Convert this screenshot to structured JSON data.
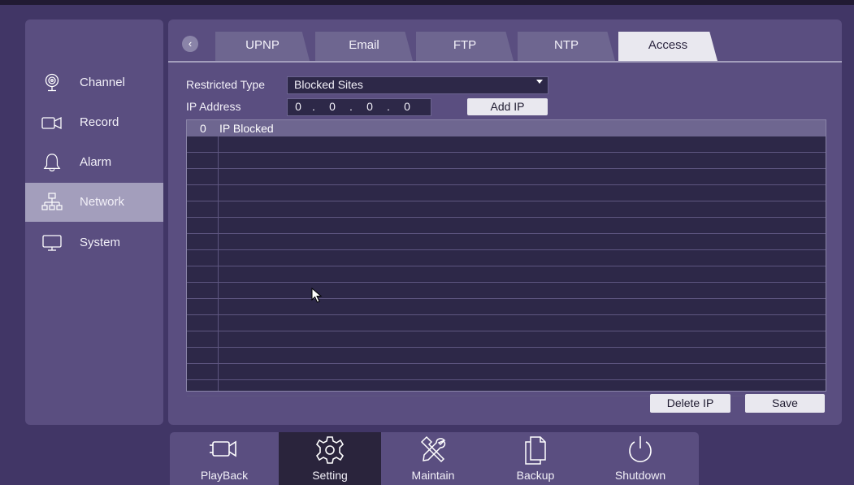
{
  "sidebar": {
    "items": [
      {
        "label": "Channel",
        "icon": "webcam-icon",
        "active": false
      },
      {
        "label": "Record",
        "icon": "camera-icon",
        "active": false
      },
      {
        "label": "Alarm",
        "icon": "bell-icon",
        "active": false
      },
      {
        "label": "Network",
        "icon": "network-icon",
        "active": true
      },
      {
        "label": "System",
        "icon": "monitor-icon",
        "active": false
      }
    ]
  },
  "tabs": {
    "back_symbol": "‹",
    "items": [
      {
        "label": "UPNP",
        "active": false
      },
      {
        "label": "Email",
        "active": false
      },
      {
        "label": "FTP",
        "active": false
      },
      {
        "label": "NTP",
        "active": false
      },
      {
        "label": "Access",
        "active": true
      }
    ]
  },
  "form": {
    "restricted_type_label": "Restricted Type",
    "restricted_type_value": "Blocked Sites",
    "ip_address_label": "IP Address",
    "ip": [
      "0",
      "0",
      "0",
      "0"
    ],
    "ip_separator": ".",
    "add_ip_label": "Add IP"
  },
  "table": {
    "count": "0",
    "header": "IP Blocked",
    "rows": []
  },
  "actions": {
    "delete_label": "Delete IP",
    "save_label": "Save"
  },
  "dock": {
    "items": [
      {
        "label": "PlayBack",
        "icon": "playback-camera-icon",
        "active": false
      },
      {
        "label": "Setting",
        "icon": "gear-icon",
        "active": true
      },
      {
        "label": "Maintain",
        "icon": "tools-icon",
        "active": false
      },
      {
        "label": "Backup",
        "icon": "backup-files-icon",
        "active": false
      },
      {
        "label": "Shutdown",
        "icon": "power-icon",
        "active": false
      }
    ]
  },
  "colors": {
    "background": "#413666",
    "panel": "#5a4e80",
    "active_sidebar": "#a39ebc",
    "active_dock": "#2a243c",
    "field": "#2d2848"
  }
}
